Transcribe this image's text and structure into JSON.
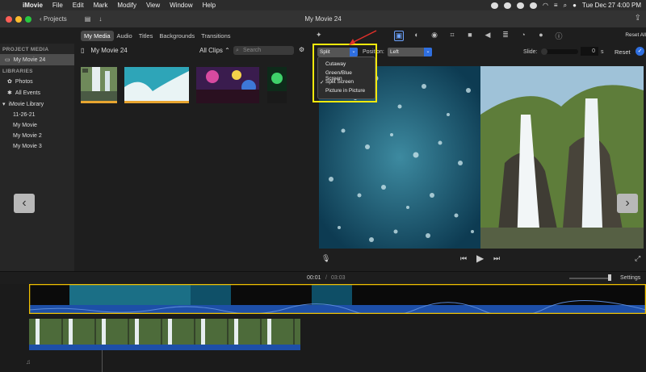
{
  "menubar": {
    "items": [
      "iMovie",
      "File",
      "Edit",
      "Mark",
      "Modify",
      "View",
      "Window",
      "Help"
    ],
    "clock": "Tue Dec 27  4:00 PM"
  },
  "toolbar": {
    "projects_label": "Projects",
    "window_title": "My Movie 24"
  },
  "tabs": [
    "My Media",
    "Audio",
    "Titles",
    "Backgrounds",
    "Transitions"
  ],
  "sidebar": {
    "project_media_heading": "PROJECT MEDIA",
    "project_item": "My Movie 24",
    "libraries_heading": "LIBRARIES",
    "photos": "Photos",
    "all_events": "All Events",
    "library_name": "iMovie Library",
    "events": [
      "11-26-21",
      "My Movie",
      "My Movie 2",
      "My Movie 3"
    ]
  },
  "browser": {
    "title": "My Movie 24",
    "filter": "All Clips",
    "search_placeholder": "Search"
  },
  "viewer": {
    "reset_all": "Reset All",
    "overlay_mode": "Split Screen",
    "position_label": "Position:",
    "position_value": "Left",
    "slide_label": "Slide:",
    "slide_value": "0",
    "slide_unit": "s",
    "reset": "Reset"
  },
  "overlay_menu": {
    "options": [
      "Cutaway",
      "Green/Blue Screen",
      "Split Screen",
      "Picture in Picture"
    ],
    "checked": "Split Screen"
  },
  "timeline": {
    "current_time": "00:01",
    "separator": "/",
    "total_time": "03:03",
    "settings": "Settings"
  },
  "colors": {
    "accent": "#2f6fe0",
    "highlight_box": "#f6e90c",
    "selection_border": "#f0c000"
  }
}
